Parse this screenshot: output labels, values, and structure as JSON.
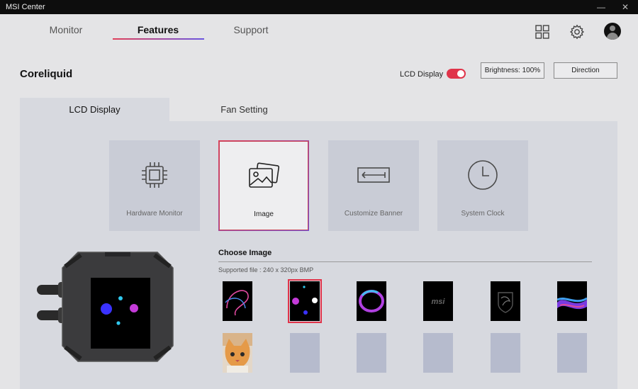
{
  "window": {
    "title": "MSI Center",
    "minimize_symbol": "—",
    "close_symbol": "✕"
  },
  "nav": {
    "tabs": [
      {
        "label": "Monitor"
      },
      {
        "label": "Features"
      },
      {
        "label": "Support"
      }
    ],
    "active_index": 1
  },
  "header": {
    "device_name": "Coreliquid",
    "lcd_toggle_label": "LCD Display",
    "lcd_toggle_on": true,
    "brightness_label": "Brightness: 100%",
    "direction_label": "Direction"
  },
  "sub_tabs": [
    {
      "label": "LCD Display"
    },
    {
      "label": "Fan Setting"
    }
  ],
  "modes": [
    {
      "label": "Hardware Monitor",
      "icon": "cpu-icon"
    },
    {
      "label": "Image",
      "icon": "image-icon"
    },
    {
      "label": "Customize Banner",
      "icon": "banner-icon"
    },
    {
      "label": "System Clock",
      "icon": "clock-icon"
    }
  ],
  "active_mode": "Image",
  "choose_image": {
    "title": "Choose Image",
    "supported": "Supported file : 240 x 320px BMP",
    "selected_index": 1,
    "thumbnails": [
      "neon-swirl-icon",
      "dots-icon",
      "ring-icon",
      "msi-logo-icon",
      "dragon-shield-icon",
      "wave-icon",
      "cat-photo-icon",
      "empty-slot",
      "empty-slot",
      "empty-slot",
      "empty-slot",
      "empty-slot"
    ],
    "thumb_logo_text": "msi"
  },
  "colors": {
    "accent_red": "#e0344a",
    "accent_purple": "#6a55e0",
    "panel": "#d7d9df",
    "card": "#c9ccd6",
    "empty_slot": "#b6bbcd"
  }
}
